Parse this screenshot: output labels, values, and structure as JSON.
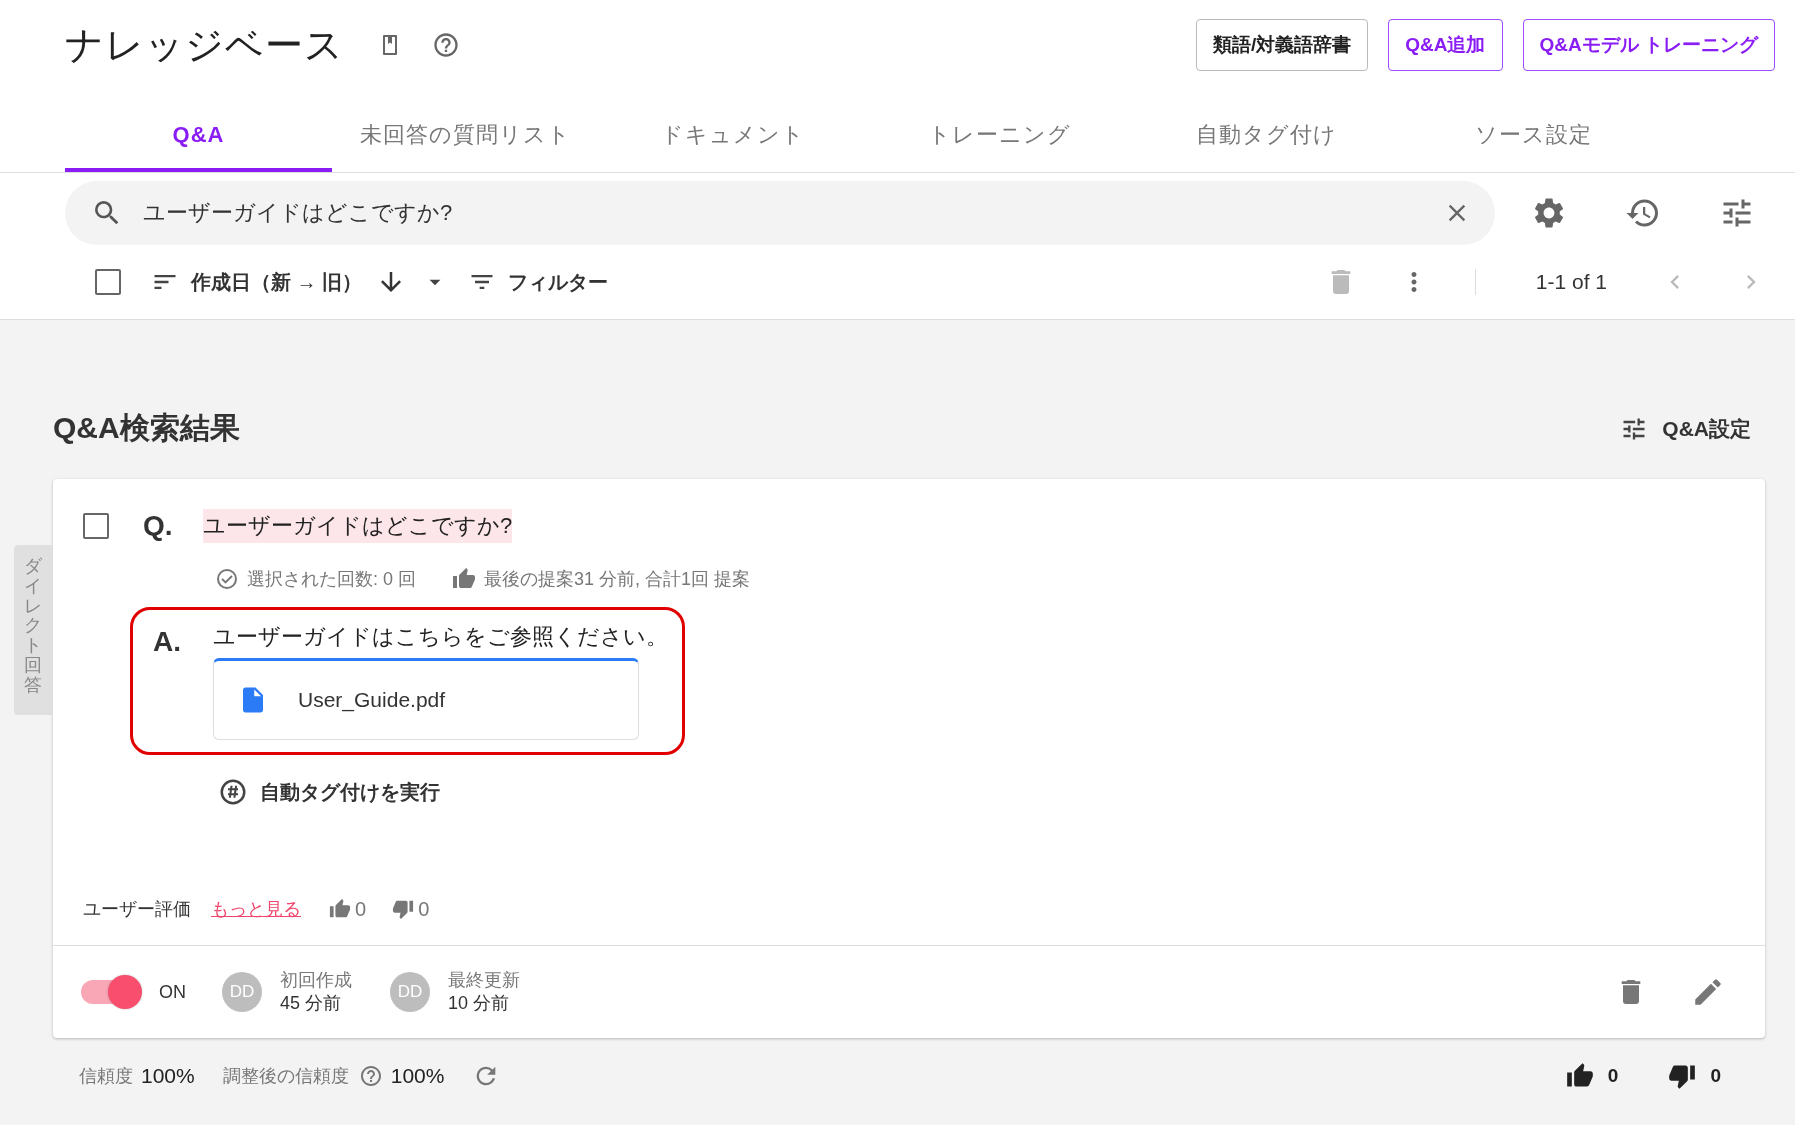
{
  "header": {
    "title": "ナレッジベース",
    "buttons": [
      {
        "label": "類語/対義語辞書",
        "kind": "neutral"
      },
      {
        "label": "Q&A追加",
        "kind": "primary"
      },
      {
        "label": "Q&Aモデル トレーニング",
        "kind": "primary"
      }
    ]
  },
  "tabs": [
    {
      "label": "Q&A",
      "selected": true
    },
    {
      "label": "未回答の質問リスト",
      "selected": false
    },
    {
      "label": "ドキュメント",
      "selected": false
    },
    {
      "label": "トレーニング",
      "selected": false
    },
    {
      "label": "自動タグ付け",
      "selected": false
    },
    {
      "label": "ソース設定",
      "selected": false
    }
  ],
  "search": {
    "value": "ユーザーガイドはどこですか?"
  },
  "toolbar": {
    "checked": false,
    "sort_label": "作成日（新 → 旧）",
    "filter_label": "フィルター",
    "pagination": "1-1 of 1"
  },
  "results": {
    "title": "Q&A検索結果",
    "settings_label": "Q&A設定",
    "side_tab": "ダイレクト回答",
    "items": [
      {
        "checked": false,
        "q_mark": "Q.",
        "question": "ユーザーガイドはどこですか?",
        "selected_count": "選択された回数: 0 回",
        "suggestion": "最後の提案31 分前, 合計1回 提案",
        "a_mark": "A.",
        "answer": "ユーザーガイドはこちらをご参照ください。",
        "attachment": "User_Guide.pdf",
        "highlighted": true,
        "auto_tag": "自動タグ付けを実行",
        "rating_label": "ユーザー評価",
        "more_link": "もっと見る",
        "likes": "0",
        "dislikes": "0",
        "enabled": true,
        "toggle_label": "ON",
        "created": {
          "avatar": "DD",
          "label": "初回作成",
          "time": "45 分前"
        },
        "updated": {
          "avatar": "DD",
          "label": "最終更新",
          "time": "10 分前"
        },
        "confidence_label": "信頼度",
        "confidence": "100%",
        "adjusted_label": "調整後の信頼度",
        "adjusted": "100%",
        "votes_up": "0",
        "votes_down": "0"
      }
    ]
  }
}
